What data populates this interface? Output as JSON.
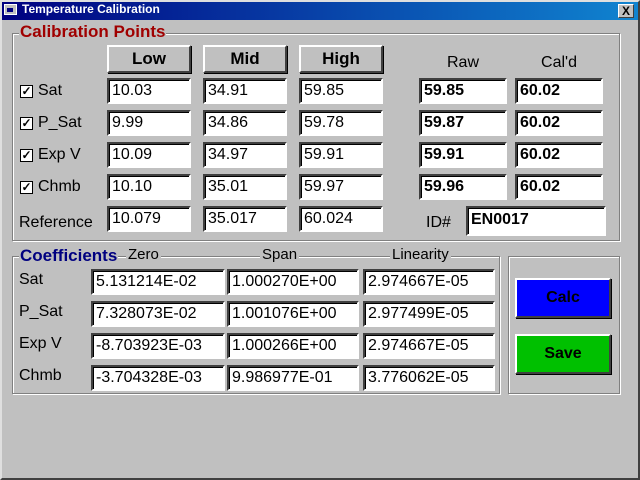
{
  "window": {
    "title": "Temperature Calibration",
    "close_glyph": "X"
  },
  "calibration": {
    "group_title": "Calibration Points",
    "columns": {
      "low": "Low",
      "mid": "Mid",
      "high": "High",
      "raw": "Raw",
      "cald": "Cal'd"
    },
    "rows": [
      {
        "label": "Sat",
        "checked": true,
        "low": "10.03",
        "mid": "34.91",
        "high": "59.85",
        "raw": "59.85",
        "cald": "60.02"
      },
      {
        "label": "P_Sat",
        "checked": true,
        "low": "9.99",
        "mid": "34.86",
        "high": "59.78",
        "raw": "59.87",
        "cald": "60.02"
      },
      {
        "label": "Exp V",
        "checked": true,
        "low": "10.09",
        "mid": "34.97",
        "high": "59.91",
        "raw": "59.91",
        "cald": "60.02"
      },
      {
        "label": "Chmb",
        "checked": true,
        "low": "10.10",
        "mid": "35.01",
        "high": "59.97",
        "raw": "59.96",
        "cald": "60.02"
      }
    ],
    "reference": {
      "label": "Reference",
      "low": "10.079",
      "mid": "35.017",
      "high": "60.024"
    },
    "id": {
      "label": "ID#",
      "value": "EN0017"
    }
  },
  "coefficients": {
    "group_title": "Coefficients",
    "columns": {
      "zero": "Zero",
      "span": "Span",
      "linearity": "Linearity"
    },
    "rows": [
      {
        "label": "Sat",
        "zero": "5.131214E-02",
        "span": "1.000270E+00",
        "linearity": "2.974667E-05"
      },
      {
        "label": "P_Sat",
        "zero": "7.328073E-02",
        "span": "1.001076E+00",
        "linearity": "2.977499E-05"
      },
      {
        "label": "Exp V",
        "zero": "-8.703923E-03",
        "span": "1.000266E+00",
        "linearity": "2.974667E-05"
      },
      {
        "label": "Chmb",
        "zero": "-3.704328E-03",
        "span": "9.986977E-01",
        "linearity": "3.776062E-05"
      }
    ]
  },
  "actions": {
    "calc": {
      "label": "Calc",
      "color": "#0000ff"
    },
    "save": {
      "label": "Save",
      "color": "#00c000"
    }
  },
  "colors": {
    "title_red": "#a00000",
    "title_blue": "#000080"
  }
}
